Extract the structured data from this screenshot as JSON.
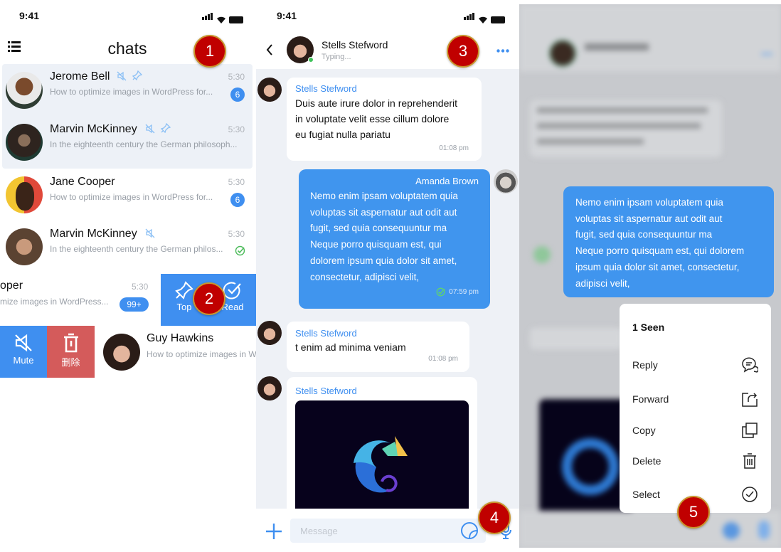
{
  "chat_list": {
    "status_time": "9:41",
    "title": "chats",
    "rows": [
      {
        "name": "Jerome Bell",
        "preview": "How to optimize images in WordPress for...",
        "time": "5:30",
        "badge": "6",
        "muted": true,
        "pinned": true
      },
      {
        "name": "Marvin McKinney",
        "preview": "In the eighteenth century the German philosoph...",
        "time": "5:30",
        "muted": true,
        "pinned": true
      },
      {
        "name": "Jane Cooper",
        "preview": "How to optimize images in WordPress for...",
        "time": "5:30",
        "badge": "6"
      },
      {
        "name": "Marvin McKinney",
        "preview": "In the eighteenth century the German philos...",
        "time": "5:30",
        "muted": true,
        "read": true
      },
      {
        "name": "oper",
        "preview": "mize images in WordPress...",
        "time": "5:30",
        "badge": "99+"
      },
      {
        "name": "Guy Hawkins",
        "preview": "How to optimize images in W"
      }
    ],
    "swipe_right_actions": {
      "top": "Top",
      "read": "Read"
    },
    "swipe_left_actions": {
      "mute": "Mute",
      "delete": "删除"
    }
  },
  "conversation": {
    "status_time": "9:41",
    "contact_name": "Stells Stefword",
    "contact_status": "Typing...",
    "messages": [
      {
        "sender": "Stells Stefword",
        "lines": [
          "Duis aute irure dolor in reprehenderit",
          "in voluptate velit esse cillum dolore",
          "eu fugiat nulla pariatu"
        ],
        "time": "01:08 pm"
      },
      {
        "sender": "Amanda Brown",
        "lines": [
          "Nemo enim ipsam voluptatem quia",
          "voluptas sit aspernatur aut odit aut",
          "fugit, sed quia consequuntur ma",
          "Neque porro quisquam est, qui",
          "dolorem ipsum quia dolor sit amet,",
          "consectetur, adipisci velit,"
        ],
        "time": "07:59 pm"
      },
      {
        "sender": "Stells Stefword",
        "lines": [
          "t enim ad minima veniam"
        ],
        "time": "01:08 pm"
      },
      {
        "sender": "Stells Stefword",
        "image": "chameleon-logo"
      }
    ],
    "input_placeholder": "Message"
  },
  "context_menu_screen": {
    "selected_message_lines": [
      "Nemo enim ipsam voluptatem quia",
      "voluptas sit aspernatur aut odit aut",
      "fugit, sed quia consequuntur ma",
      "Neque porro quisquam est, qui dolorem",
      "ipsum quia dolor sit amet, consectetur,",
      "adipisci velit,"
    ],
    "seen": "1 Seen",
    "menu": [
      {
        "label": "Reply",
        "icon": "reply-bubble-icon"
      },
      {
        "label": "Forward",
        "icon": "forward-icon"
      },
      {
        "label": "Copy",
        "icon": "copy-icon"
      },
      {
        "label": "Delete",
        "icon": "trash-icon"
      },
      {
        "label": "Select",
        "icon": "check-circle-icon"
      }
    ]
  },
  "markers": [
    "1",
    "2",
    "3",
    "4",
    "5"
  ],
  "colors": {
    "accent": "#3f8ff0",
    "delete": "#d45b5b",
    "marker": "#c00000",
    "chat_bg": "#eef1f6",
    "highlight": "#edf1f7"
  }
}
